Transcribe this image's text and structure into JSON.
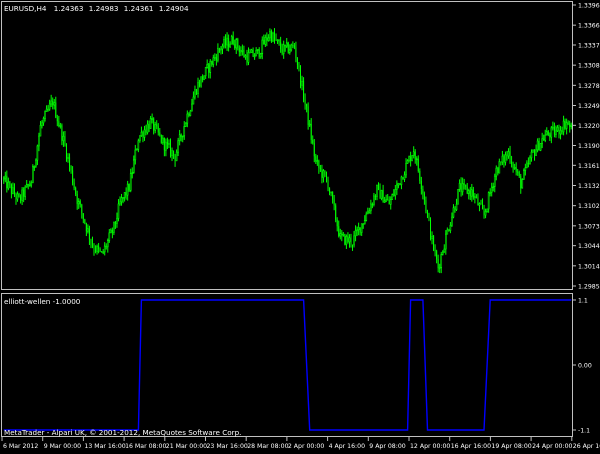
{
  "chart_window": {
    "symbol_label": "EURUSD,H4",
    "ohlc": [
      "1.24363",
      "1.24983",
      "1.24361",
      "1.24904"
    ],
    "copyright": "MetaTrader - Alpari UK, © 2001-2012, MetaQuotes Software Corp."
  },
  "indicator": {
    "label": "elliott-wellen -1.0000",
    "scale_labels": [
      "1.1",
      "0.00",
      "-1.1"
    ]
  },
  "colors": {
    "background": "#000000",
    "frame": "#c0c0c0",
    "up_candle": "#00ff00",
    "down_candle": "#00ff00",
    "indicator_line": "#0000ff",
    "text": "#ffffff"
  },
  "chart_data": [
    {
      "type": "candlestick",
      "title": "EURUSD,H4",
      "x": [
        "6 Mar 2012",
        "9 Mar 00:00",
        "13 Mar 16:00",
        "16 Mar 08:00",
        "21 Mar 00:00",
        "23 Mar 16:00",
        "28 Mar 08:00",
        "2 Apr 00:00",
        "4 Apr 16:00",
        "9 Apr 08:00",
        "12 Apr 00:00",
        "16 Apr 16:00",
        "19 Apr 08:00",
        "24 Apr 00:00",
        "26 Apr 16:00"
      ],
      "y_ticks": [
        "1.33960",
        "1.33665",
        "1.33375",
        "1.33080",
        "1.32785",
        "1.32490",
        "1.32200",
        "1.31905",
        "1.31615",
        "1.31320",
        "1.31025",
        "1.30730",
        "1.30440",
        "1.30145",
        "1.29850"
      ],
      "ylim": [
        1.2985,
        1.3396
      ],
      "close_anchors": [
        {
          "t": 0,
          "v": 1.314
        },
        {
          "t": 10,
          "v": 1.311
        },
        {
          "t": 18,
          "v": 1.3138
        },
        {
          "t": 24,
          "v": 1.3218
        },
        {
          "t": 32,
          "v": 1.3255
        },
        {
          "t": 40,
          "v": 1.319
        },
        {
          "t": 48,
          "v": 1.3112
        },
        {
          "t": 58,
          "v": 1.3045
        },
        {
          "t": 64,
          "v": 1.303
        },
        {
          "t": 72,
          "v": 1.307
        },
        {
          "t": 76,
          "v": 1.3105
        },
        {
          "t": 82,
          "v": 1.313
        },
        {
          "t": 88,
          "v": 1.3202
        },
        {
          "t": 96,
          "v": 1.3225
        },
        {
          "t": 104,
          "v": 1.3195
        },
        {
          "t": 112,
          "v": 1.3175
        },
        {
          "t": 120,
          "v": 1.3235
        },
        {
          "t": 126,
          "v": 1.3275
        },
        {
          "t": 134,
          "v": 1.3305
        },
        {
          "t": 142,
          "v": 1.3335
        },
        {
          "t": 150,
          "v": 1.3345
        },
        {
          "t": 158,
          "v": 1.332
        },
        {
          "t": 166,
          "v": 1.3325
        },
        {
          "t": 174,
          "v": 1.3355
        },
        {
          "t": 182,
          "v": 1.333
        },
        {
          "t": 190,
          "v": 1.3335
        },
        {
          "t": 198,
          "v": 1.324
        },
        {
          "t": 204,
          "v": 1.3165
        },
        {
          "t": 212,
          "v": 1.3135
        },
        {
          "t": 220,
          "v": 1.3055
        },
        {
          "t": 228,
          "v": 1.305
        },
        {
          "t": 236,
          "v": 1.3085
        },
        {
          "t": 244,
          "v": 1.3125
        },
        {
          "t": 252,
          "v": 1.3105
        },
        {
          "t": 260,
          "v": 1.3145
        },
        {
          "t": 268,
          "v": 1.3185
        },
        {
          "t": 274,
          "v": 1.3125
        },
        {
          "t": 280,
          "v": 1.305
        },
        {
          "t": 284,
          "v": 1.3012
        },
        {
          "t": 290,
          "v": 1.3065
        },
        {
          "t": 298,
          "v": 1.3128
        },
        {
          "t": 306,
          "v": 1.3122
        },
        {
          "t": 314,
          "v": 1.3088
        },
        {
          "t": 322,
          "v": 1.3155
        },
        {
          "t": 330,
          "v": 1.318
        },
        {
          "t": 338,
          "v": 1.3135
        },
        {
          "t": 346,
          "v": 1.318
        },
        {
          "t": 354,
          "v": 1.3205
        },
        {
          "t": 362,
          "v": 1.3212
        },
        {
          "t": 368,
          "v": 1.3225
        },
        {
          "t": 371,
          "v": 1.3215
        }
      ]
    },
    {
      "type": "line",
      "title": "elliott-wellen -1.0000",
      "ylim": [
        -1.1,
        1.1
      ],
      "points": [
        {
          "t": 0,
          "v": -1.1
        },
        {
          "t": 88,
          "v": -1.1
        },
        {
          "t": 90,
          "v": 1.1
        },
        {
          "t": 196,
          "v": 1.1
        },
        {
          "t": 200,
          "v": -1.1
        },
        {
          "t": 264,
          "v": -1.1
        },
        {
          "t": 266,
          "v": 1.1
        },
        {
          "t": 274,
          "v": 1.1
        },
        {
          "t": 277,
          "v": -1.1
        },
        {
          "t": 314,
          "v": -1.1
        },
        {
          "t": 318,
          "v": 1.1
        },
        {
          "t": 371,
          "v": 1.1
        }
      ]
    }
  ]
}
